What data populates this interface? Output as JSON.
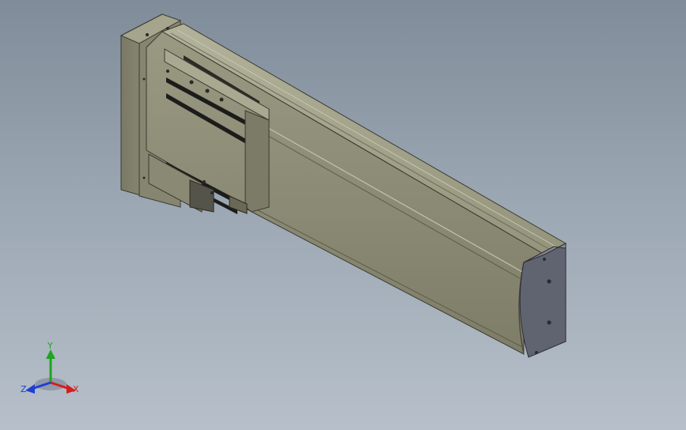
{
  "viewport": {
    "background_top": "#7f8c99",
    "background_bottom": "#b7c0ca"
  },
  "model": {
    "body_color": "#8b8a74",
    "body_dark": "#5f5e4d",
    "body_light": "#a8a78f",
    "end_cap_color": "#606470",
    "slot_color": "#1c1c1a"
  },
  "triad": {
    "x_label": "X",
    "y_label": "Y",
    "z_label": "Z",
    "x_color": "#d21f1f",
    "y_color": "#1fa51f",
    "z_color": "#1f3fd2"
  }
}
